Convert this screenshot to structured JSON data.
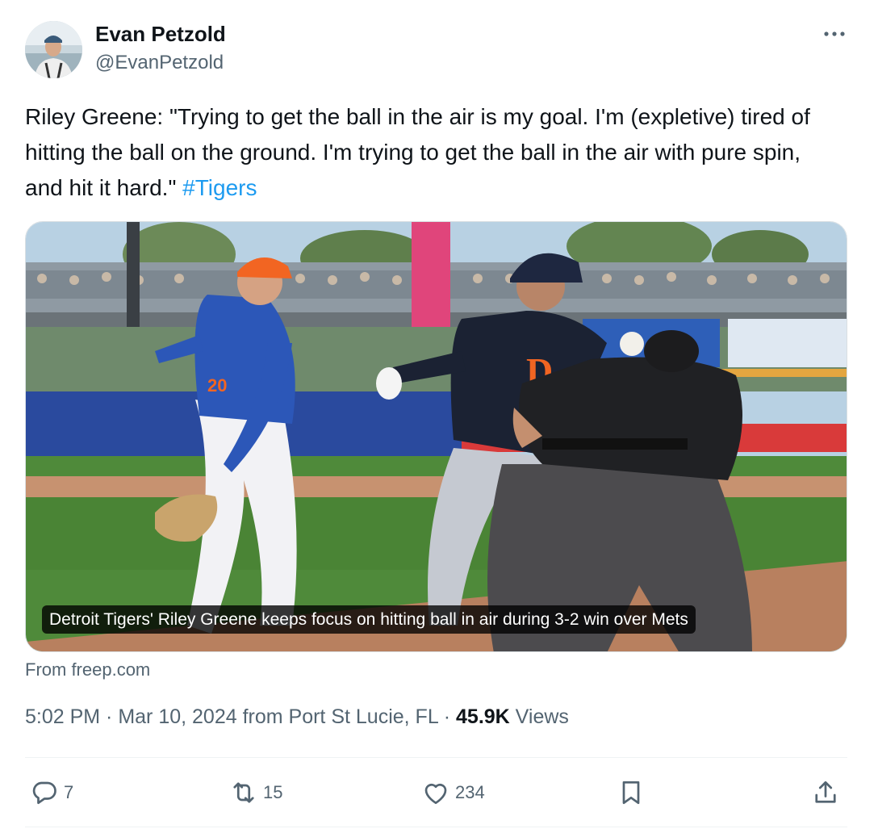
{
  "author": {
    "display_name": "Evan Petzold",
    "handle": "@EvanPetzold"
  },
  "tweet": {
    "text_before_tag": "Riley Greene: \"Trying to get the ball in the air is my goal. I'm (expletive) tired of hitting the ball on the ground. I'm trying to get the ball in the air with pure spin, and hit it hard.\" ",
    "hashtag": "#Tigers"
  },
  "card": {
    "caption": "Detroit Tigers' Riley Greene keeps focus on hitting ball in air during 3-2 win over Mets",
    "source": "From freep.com"
  },
  "meta": {
    "time_date_location": "5:02 PM · Mar 10, 2024 from Port St Lucie, FL · ",
    "views_count": "45.9K",
    "views_label": " Views"
  },
  "actions": {
    "reply_count": "7",
    "retweet_count": "15",
    "like_count": "234"
  },
  "icons": [
    "more-icon",
    "reply-icon",
    "retweet-icon",
    "like-icon",
    "bookmark-icon",
    "share-icon"
  ],
  "colors": {
    "link": "#1d9bf0",
    "secondary_text": "#536471",
    "primary_text": "#0f1419"
  }
}
